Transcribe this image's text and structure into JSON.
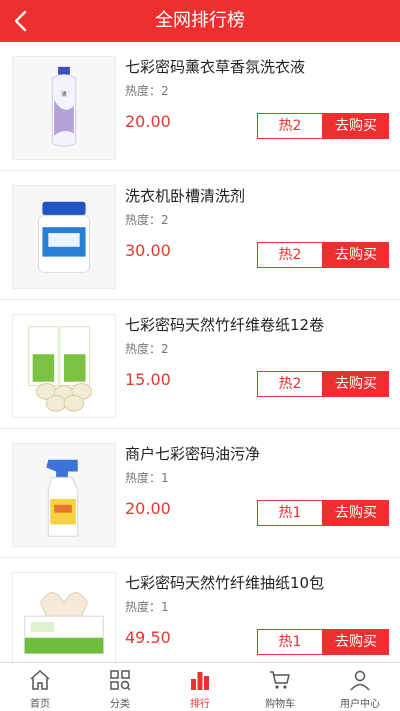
{
  "header": {
    "title": "全网排行榜",
    "back_icon": "chevron-left-icon"
  },
  "labels": {
    "heat_prefix": "热度：",
    "hot_prefix": "热",
    "buy": "去购买"
  },
  "products": [
    {
      "name": "七彩密码薰衣草香氛洗衣液",
      "heat": "2",
      "price": "20.00",
      "hot_label": "热2",
      "image": "bottle-image"
    },
    {
      "name": "洗衣机卧槽清洗剂",
      "heat": "2",
      "price": "30.00",
      "hot_label": "热2",
      "image": "jar-image"
    },
    {
      "name": "七彩密码天然竹纤维卷纸12卷",
      "heat": "2",
      "price": "15.00",
      "hot_label": "热2",
      "image": "tissue-roll-image"
    },
    {
      "name": "商户七彩密码油污净",
      "heat": "1",
      "price": "20.00",
      "hot_label": "热1",
      "image": "spray-bottle-image"
    },
    {
      "name": "七彩密码天然竹纤维抽纸10包",
      "heat": "1",
      "price": "49.50",
      "hot_label": "热1",
      "image": "tissue-box-image"
    }
  ],
  "tabbar": [
    {
      "label": "首页",
      "icon": "home-icon",
      "active": false
    },
    {
      "label": "分类",
      "icon": "category-icon",
      "active": false
    },
    {
      "label": "排行",
      "icon": "ranking-icon",
      "active": true
    },
    {
      "label": "购物车",
      "icon": "cart-icon",
      "active": false
    },
    {
      "label": "用户中心",
      "icon": "user-icon",
      "active": false
    }
  ],
  "colors": {
    "brand": "#ef2f2f",
    "price": "#e33a2f",
    "tab_inactive": "#555555"
  }
}
